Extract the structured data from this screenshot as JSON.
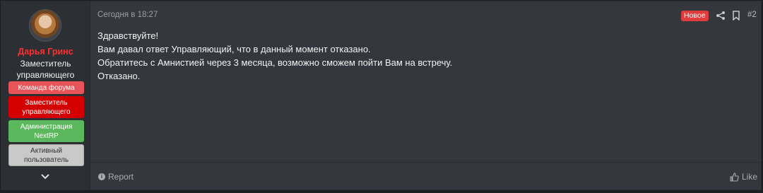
{
  "user": {
    "name": "Дарья Гринс",
    "title_line1": "Заместитель",
    "title_line2": "управляющего",
    "banners": [
      {
        "line1": "Команда форума",
        "line2": ""
      },
      {
        "line1": "Заместитель",
        "line2": "управляющего"
      },
      {
        "line1": "Администрация",
        "line2": "NextRP"
      },
      {
        "line1": "Активный",
        "line2": "пользователь"
      }
    ],
    "avatar_icon": "avatar-portrait",
    "expand_icon": "chevron-down-icon"
  },
  "post": {
    "date": "Сегодня в 18:27",
    "badge": "Новое",
    "number": "#2",
    "lines": [
      "Здравствуйте!",
      "Вам давал ответ Управляющий, что в данный момент отказано.",
      "Обратитесь с Амнистией через 3 месяца, возможно сможем пойти Вам на встречу.",
      "Отказано."
    ]
  },
  "actions": {
    "report_label": "Report",
    "like_label": "Like"
  },
  "colors": {
    "username": "#ff3030",
    "badge": "#e03c3c",
    "banner_team": "#e9545a",
    "banner_deputy": "#d40000",
    "banner_admin": "#5cb85c",
    "banner_active": "#c9c9c9"
  }
}
